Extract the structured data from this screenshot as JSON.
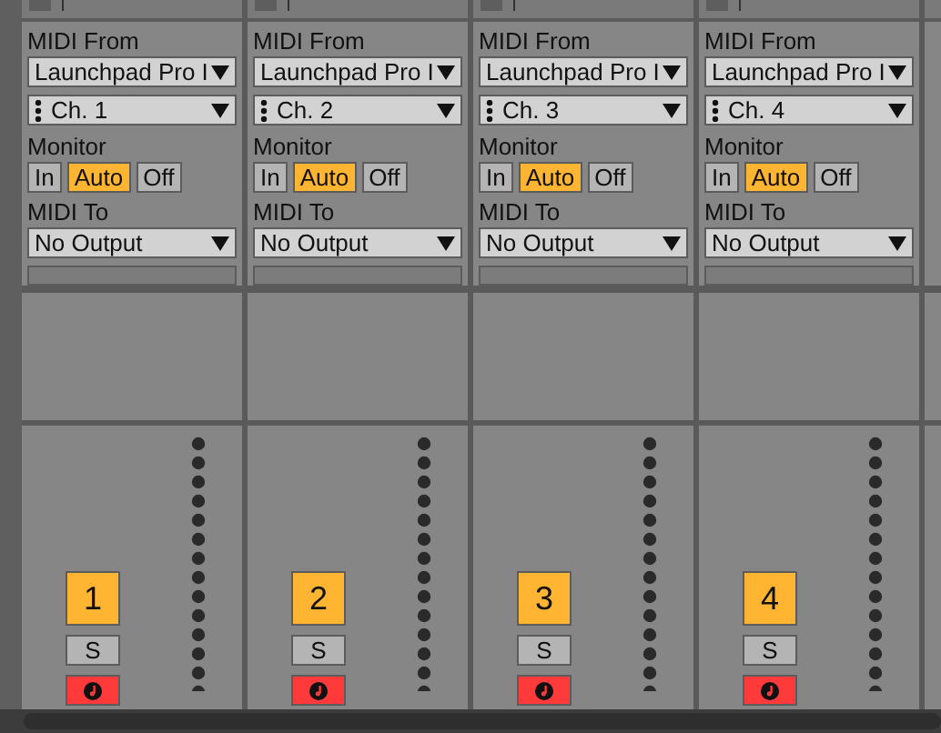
{
  "tracks": [
    {
      "midi_from": {
        "label": "MIDI From",
        "value": "Launchpad Pro I"
      },
      "channel": "Ch. 1",
      "monitor": {
        "label": "Monitor",
        "options": [
          {
            "label": "In",
            "selected": false
          },
          {
            "label": "Auto",
            "selected": true
          },
          {
            "label": "Off",
            "selected": false
          }
        ]
      },
      "midi_to": {
        "label": "MIDI To",
        "value": "No Output"
      },
      "number": "1",
      "solo": {
        "label": "S",
        "on": false
      },
      "armed": true
    },
    {
      "midi_from": {
        "label": "MIDI From",
        "value": "Launchpad Pro I"
      },
      "channel": "Ch. 2",
      "monitor": {
        "label": "Monitor",
        "options": [
          {
            "label": "In",
            "selected": false
          },
          {
            "label": "Auto",
            "selected": true
          },
          {
            "label": "Off",
            "selected": false
          }
        ]
      },
      "midi_to": {
        "label": "MIDI To",
        "value": "No Output"
      },
      "number": "2",
      "solo": {
        "label": "S",
        "on": false
      },
      "armed": true
    },
    {
      "midi_from": {
        "label": "MIDI From",
        "value": "Launchpad Pro I"
      },
      "channel": "Ch. 3",
      "monitor": {
        "label": "Monitor",
        "options": [
          {
            "label": "In",
            "selected": false
          },
          {
            "label": "Auto",
            "selected": true
          },
          {
            "label": "Off",
            "selected": false
          }
        ]
      },
      "midi_to": {
        "label": "MIDI To",
        "value": "No Output"
      },
      "number": "3",
      "solo": {
        "label": "S",
        "on": false
      },
      "armed": true
    },
    {
      "midi_from": {
        "label": "MIDI From",
        "value": "Launchpad Pro I"
      },
      "channel": "Ch. 4",
      "monitor": {
        "label": "Monitor",
        "options": [
          {
            "label": "In",
            "selected": false
          },
          {
            "label": "Auto",
            "selected": true
          },
          {
            "label": "Off",
            "selected": false
          }
        ]
      },
      "midi_to": {
        "label": "MIDI To",
        "value": "No Output"
      },
      "number": "4",
      "solo": {
        "label": "S",
        "on": false
      },
      "armed": true
    }
  ]
}
